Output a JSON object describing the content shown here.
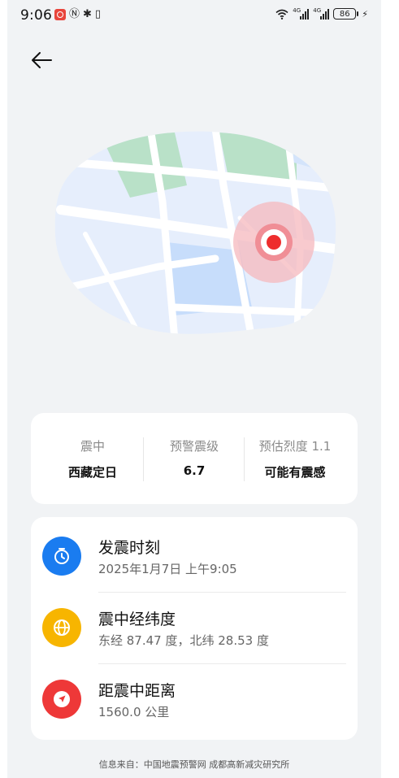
{
  "status_bar": {
    "time": "9:06",
    "battery": "86",
    "net_1": "4G",
    "net_2": "4G"
  },
  "summary": {
    "epicenter_label": "震中",
    "epicenter_value": "西藏定日",
    "magnitude_label": "预警震级",
    "magnitude_value": "6.7",
    "intensity_label": "预估烈度 1.1",
    "intensity_value": "可能有震感"
  },
  "details": [
    {
      "title": "发震时刻",
      "value": "2025年1月7日 上午9:05",
      "icon": "clock-icon",
      "color": "#1a7cf0"
    },
    {
      "title": "震中经纬度",
      "value": "东经 87.47 度，北纬 28.53 度",
      "icon": "globe-icon",
      "color": "#f7b500"
    },
    {
      "title": "距震中距离",
      "value": "1560.0 公里",
      "icon": "navigation-icon",
      "color": "#ee3838"
    }
  ],
  "footer": "信息来自：中国地震预警网 成都高新减灾研究所",
  "colors": {
    "map_base": "#e6eefc",
    "map_water": "#c7ddfb",
    "map_park": "#b9e1c8",
    "epicenter": "#ee2d2d"
  }
}
